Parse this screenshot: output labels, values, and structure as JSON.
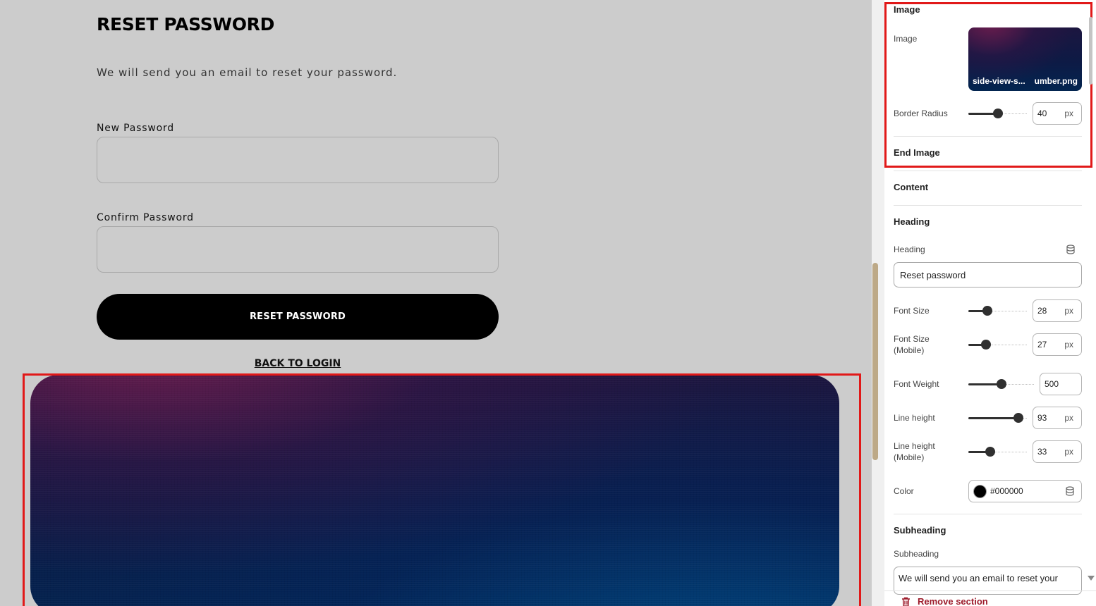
{
  "preview": {
    "heading": "RESET PASSWORD",
    "subheading": "We will send you an email to reset your password.",
    "new_password_label": "New Password",
    "confirm_password_label": "Confirm Password",
    "reset_button": "RESET PASSWORD",
    "back_link": "BACK TO LOGIN"
  },
  "panel": {
    "image_section": {
      "title": "Image",
      "image_label": "Image",
      "file_name_start": "side-view-s...",
      "file_name_end": "umber.png",
      "border_radius_label": "Border Radius",
      "border_radius_value": "40",
      "border_radius_level": 0.5,
      "unit": "px",
      "end_title": "End Image"
    },
    "content_title": "Content",
    "heading_section": {
      "title": "Heading",
      "heading_label": "Heading",
      "heading_value": "Reset password",
      "font_size_label": "Font Size",
      "font_size_value": "28",
      "font_size_level": 0.33,
      "font_size_mobile_label_1": "Font Size",
      "font_size_mobile_label_2": "(Mobile)",
      "font_size_mobile_value": "27",
      "font_size_mobile_level": 0.3,
      "font_weight_label": "Font Weight",
      "font_weight_value": "500",
      "font_weight_level": 0.5,
      "line_height_label": "Line height",
      "line_height_value": "93",
      "line_height_level": 0.85,
      "line_height_mobile_label_1": "Line height",
      "line_height_mobile_label_2": "(Mobile)",
      "line_height_mobile_value": "33",
      "line_height_mobile_level": 0.37,
      "color_label": "Color",
      "color_value": "#000000",
      "unit": "px"
    },
    "subheading_section": {
      "title": "Subheading",
      "subheading_label": "Subheading",
      "subheading_value": "We will send you an email to reset your"
    },
    "remove_label": "Remove section"
  },
  "colors": {
    "canvas_bg": "#cccccc",
    "highlight": "#e11919",
    "scroll_thumb": "#bda987",
    "remove_text": "#9c1a2a"
  }
}
